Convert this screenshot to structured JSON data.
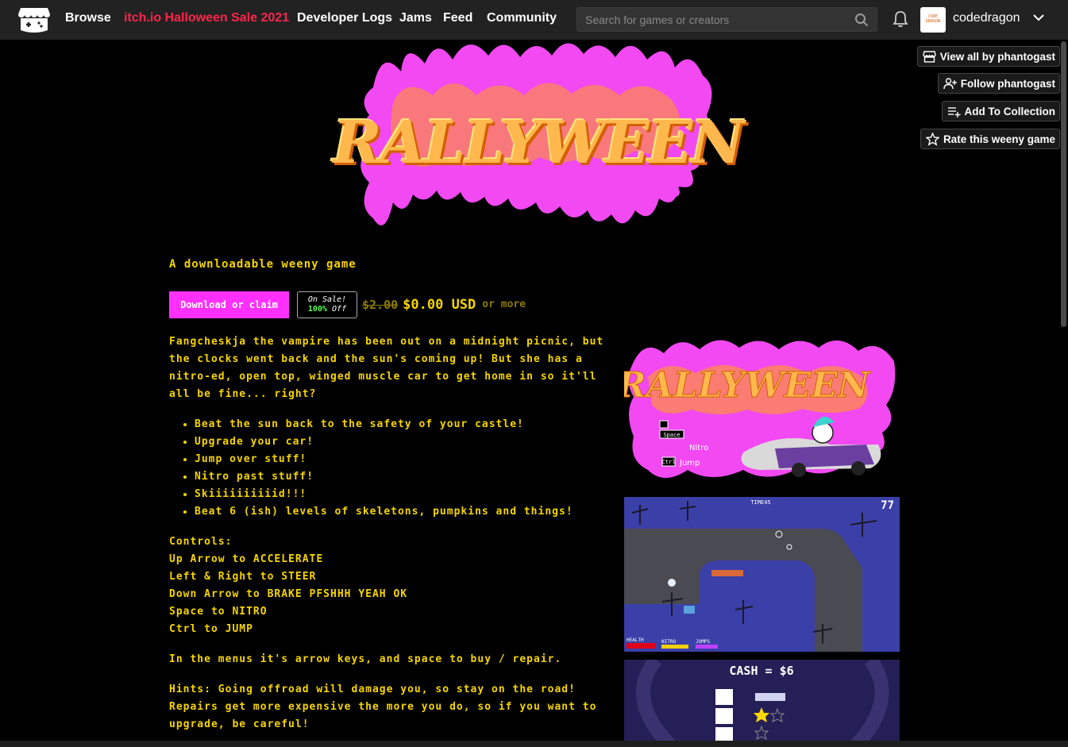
{
  "nav": {
    "browse": "Browse",
    "sale": "itch.io Halloween Sale 2021",
    "devlogs": "Developer Logs",
    "jams": "Jams",
    "feed": "Feed",
    "community": "Community",
    "search_placeholder": "Search for games or creators",
    "username": "codedragon",
    "avatar_text": "CODE DRAGON"
  },
  "side_buttons": {
    "view_all": "View all by phantogast",
    "follow": "Follow phantogast",
    "collection": "Add To Collection",
    "rate": "Rate this weeny game"
  },
  "banner": {
    "title": "RALLYWEEN"
  },
  "game": {
    "tagline": "A downloadable weeny game",
    "download_label": "Download or claim",
    "sale_line1": "On Sale!",
    "sale_pct": "100%",
    "sale_off": "Off",
    "old_price": "$2.00",
    "new_price": "$0.00 USD",
    "or_more": "or more",
    "intro": "Fangcheskja the vampire has been out on a midnight picnic, but the clocks went back and the sun's coming up! But she has a nitro-ed, open top, winged muscle car to get home in so it'll all be fine... right?",
    "features": [
      "Beat the sun back to the safety of your castle!",
      "Upgrade your car!",
      "Jump over stuff!",
      "Nitro past stuff!",
      "Skiiiiiiiiiid!!!",
      "Beat 6 (ish) levels of skeletons, pumpkins and things!"
    ],
    "controls": [
      "Controls:",
      "Up Arrow to ACCELERATE",
      "Left & Right to STEER",
      "Down Arrow to BRAKE PFSHHH YEAH OK",
      "Space to NITRO",
      "Ctrl to JUMP"
    ],
    "menus": "In the menus it's arrow keys, and space to buy / repair.",
    "hints": "Hints: Going offroad will damage you, so stay on the road! Repairs get more expensive the more you do, so if you want to upgrade, be careful!"
  },
  "screenshots": {
    "one": {
      "title": "RALLYWEEN",
      "key_space": "Space",
      "label_nitro": "Nitro",
      "key_ctrl": "Ctrl",
      "label_jump": "Jump"
    },
    "two": {
      "timer_label": "TIME45",
      "counter": "77",
      "health": "HEALTH",
      "nitro": "NITRO",
      "jumps": "JUMPS"
    },
    "three": {
      "cash": "CASH = $6"
    }
  },
  "colors": {
    "accent": "#ff30ff",
    "text": "#f5d400",
    "sale": "#ff2449",
    "topbar": "#222222"
  }
}
